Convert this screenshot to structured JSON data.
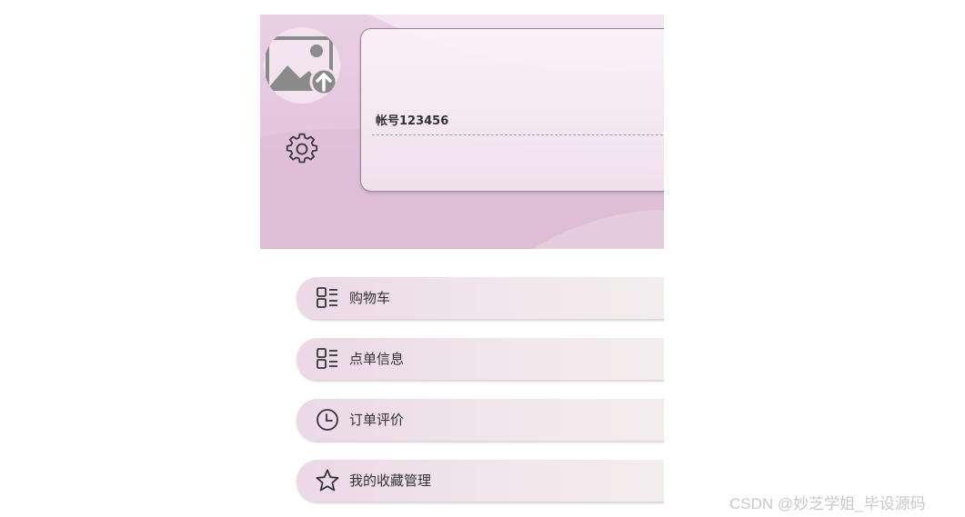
{
  "profile": {
    "account_label": "帐号123456",
    "avatar_icon": "image-upload-icon",
    "settings_icon": "gear-icon"
  },
  "menu": {
    "items": [
      {
        "label": "购物车",
        "icon": "list-grid-icon"
      },
      {
        "label": "点单信息",
        "icon": "list-grid-icon"
      },
      {
        "label": "订单评价",
        "icon": "clock-icon"
      },
      {
        "label": "我的收藏管理",
        "icon": "star-icon"
      }
    ]
  },
  "watermark": "CSDN @妙芝学姐_毕设源码",
  "colors": {
    "header_bg": "#e3c4dd",
    "card_border": "#9a7f93",
    "menu_bg": "#ecd8e7",
    "text": "#333333"
  }
}
